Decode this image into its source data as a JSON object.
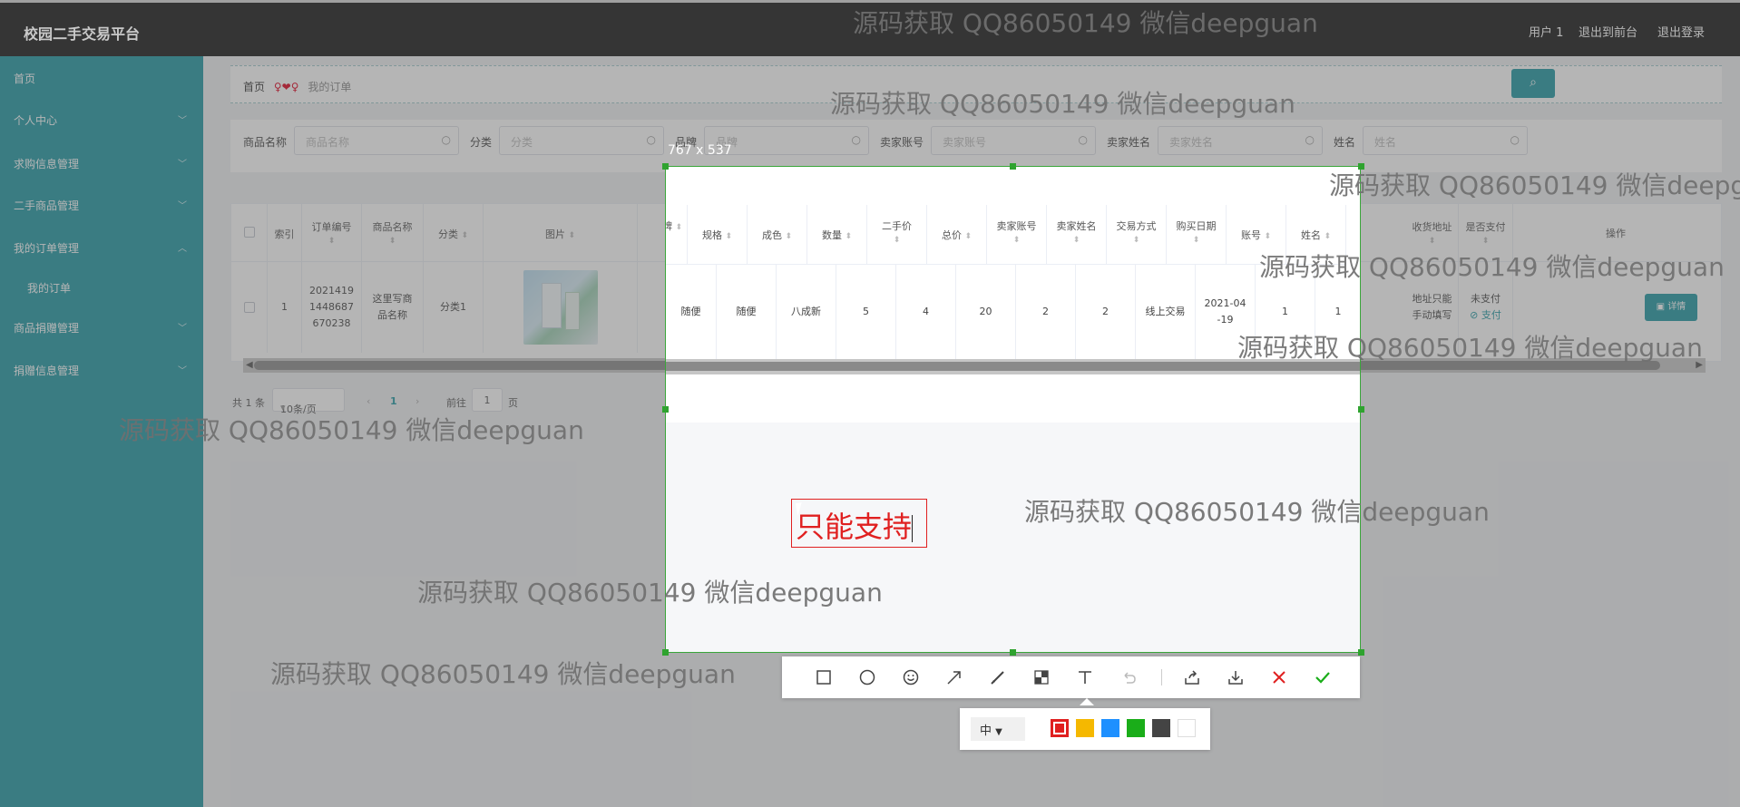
{
  "topbar": {
    "title": "校园二手交易平台",
    "links": [
      "用户 1",
      "退出到前台",
      "退出登录"
    ]
  },
  "sidebar": {
    "items": [
      {
        "label": "首页",
        "chevron": ""
      },
      {
        "label": "个人中心",
        "chevron": "﹀"
      },
      {
        "label": "求购信息管理",
        "chevron": "﹀"
      },
      {
        "label": "二手商品管理",
        "chevron": "﹀"
      },
      {
        "label": "我的订单管理",
        "chevron": "︿"
      },
      {
        "label": "我的订单",
        "chevron": ""
      },
      {
        "label": "商品捐赠管理",
        "chevron": "﹀"
      },
      {
        "label": "捐赠信息管理",
        "chevron": "﹀"
      }
    ]
  },
  "breadcrumb": {
    "home": "首页",
    "sep": "♀❤♀",
    "current": "我的订单"
  },
  "search": {
    "fields": [
      {
        "label": "商品名称",
        "placeholder": "商品名称"
      },
      {
        "label": "分类",
        "placeholder": "分类"
      },
      {
        "label": "品牌",
        "placeholder": "品牌"
      },
      {
        "label": "卖家账号",
        "placeholder": "卖家账号"
      },
      {
        "label": "卖家姓名",
        "placeholder": "卖家姓名"
      },
      {
        "label": "姓名",
        "placeholder": "姓名"
      }
    ],
    "button_icon": "search-icon"
  },
  "table": {
    "headers": [
      "索引",
      "订单编号",
      "商品名称",
      "分类",
      "图片",
      "品牌",
      "规格",
      "成色",
      "数量",
      "二手价",
      "总价",
      "卖家账号",
      "卖家姓名",
      "交易方式",
      "购买日期",
      "账号",
      "姓名",
      "收货地址",
      "是否支付",
      "操作"
    ],
    "row": {
      "index": "1",
      "order_no": "2021419 1448687 670238",
      "name": "这里写商 品名称",
      "category": "分类1",
      "brand": "随便",
      "spec": "随便",
      "condition": "八成新",
      "qty": "5",
      "price": "4",
      "total": "20",
      "seller_acct": "2",
      "seller_name": "2",
      "trade": "线上交易",
      "date": "2021-04 -19",
      "account": "1",
      "username": "1",
      "address": "地址只能 手动填写",
      "paid": "未支付",
      "pay_link": "支付",
      "detail": "详情"
    }
  },
  "pager": {
    "total": "共 1 条",
    "per_page": "10条/页",
    "prev": "‹",
    "page": "1",
    "next": "›",
    "goto": "前往",
    "goto_page": "1",
    "page_unit": "页"
  },
  "capture": {
    "size_label": "767 x 537",
    "typed_text": "只能支持"
  },
  "annotation_toolbar": {
    "tools": [
      "rectangle-icon",
      "ellipse-icon",
      "emoji-icon",
      "arrow-icon",
      "pen-icon",
      "mosaic-icon",
      "text-icon",
      "undo-icon",
      "share-icon",
      "download-icon",
      "cancel-icon",
      "confirm-icon"
    ],
    "font_size": "中",
    "colors": [
      "#e02020",
      "#f5b800",
      "#1e90ff",
      "#1aad19",
      "#444444",
      "#ffffff"
    ]
  },
  "watermark": "源码获取 QQ86050149 微信deepguan"
}
